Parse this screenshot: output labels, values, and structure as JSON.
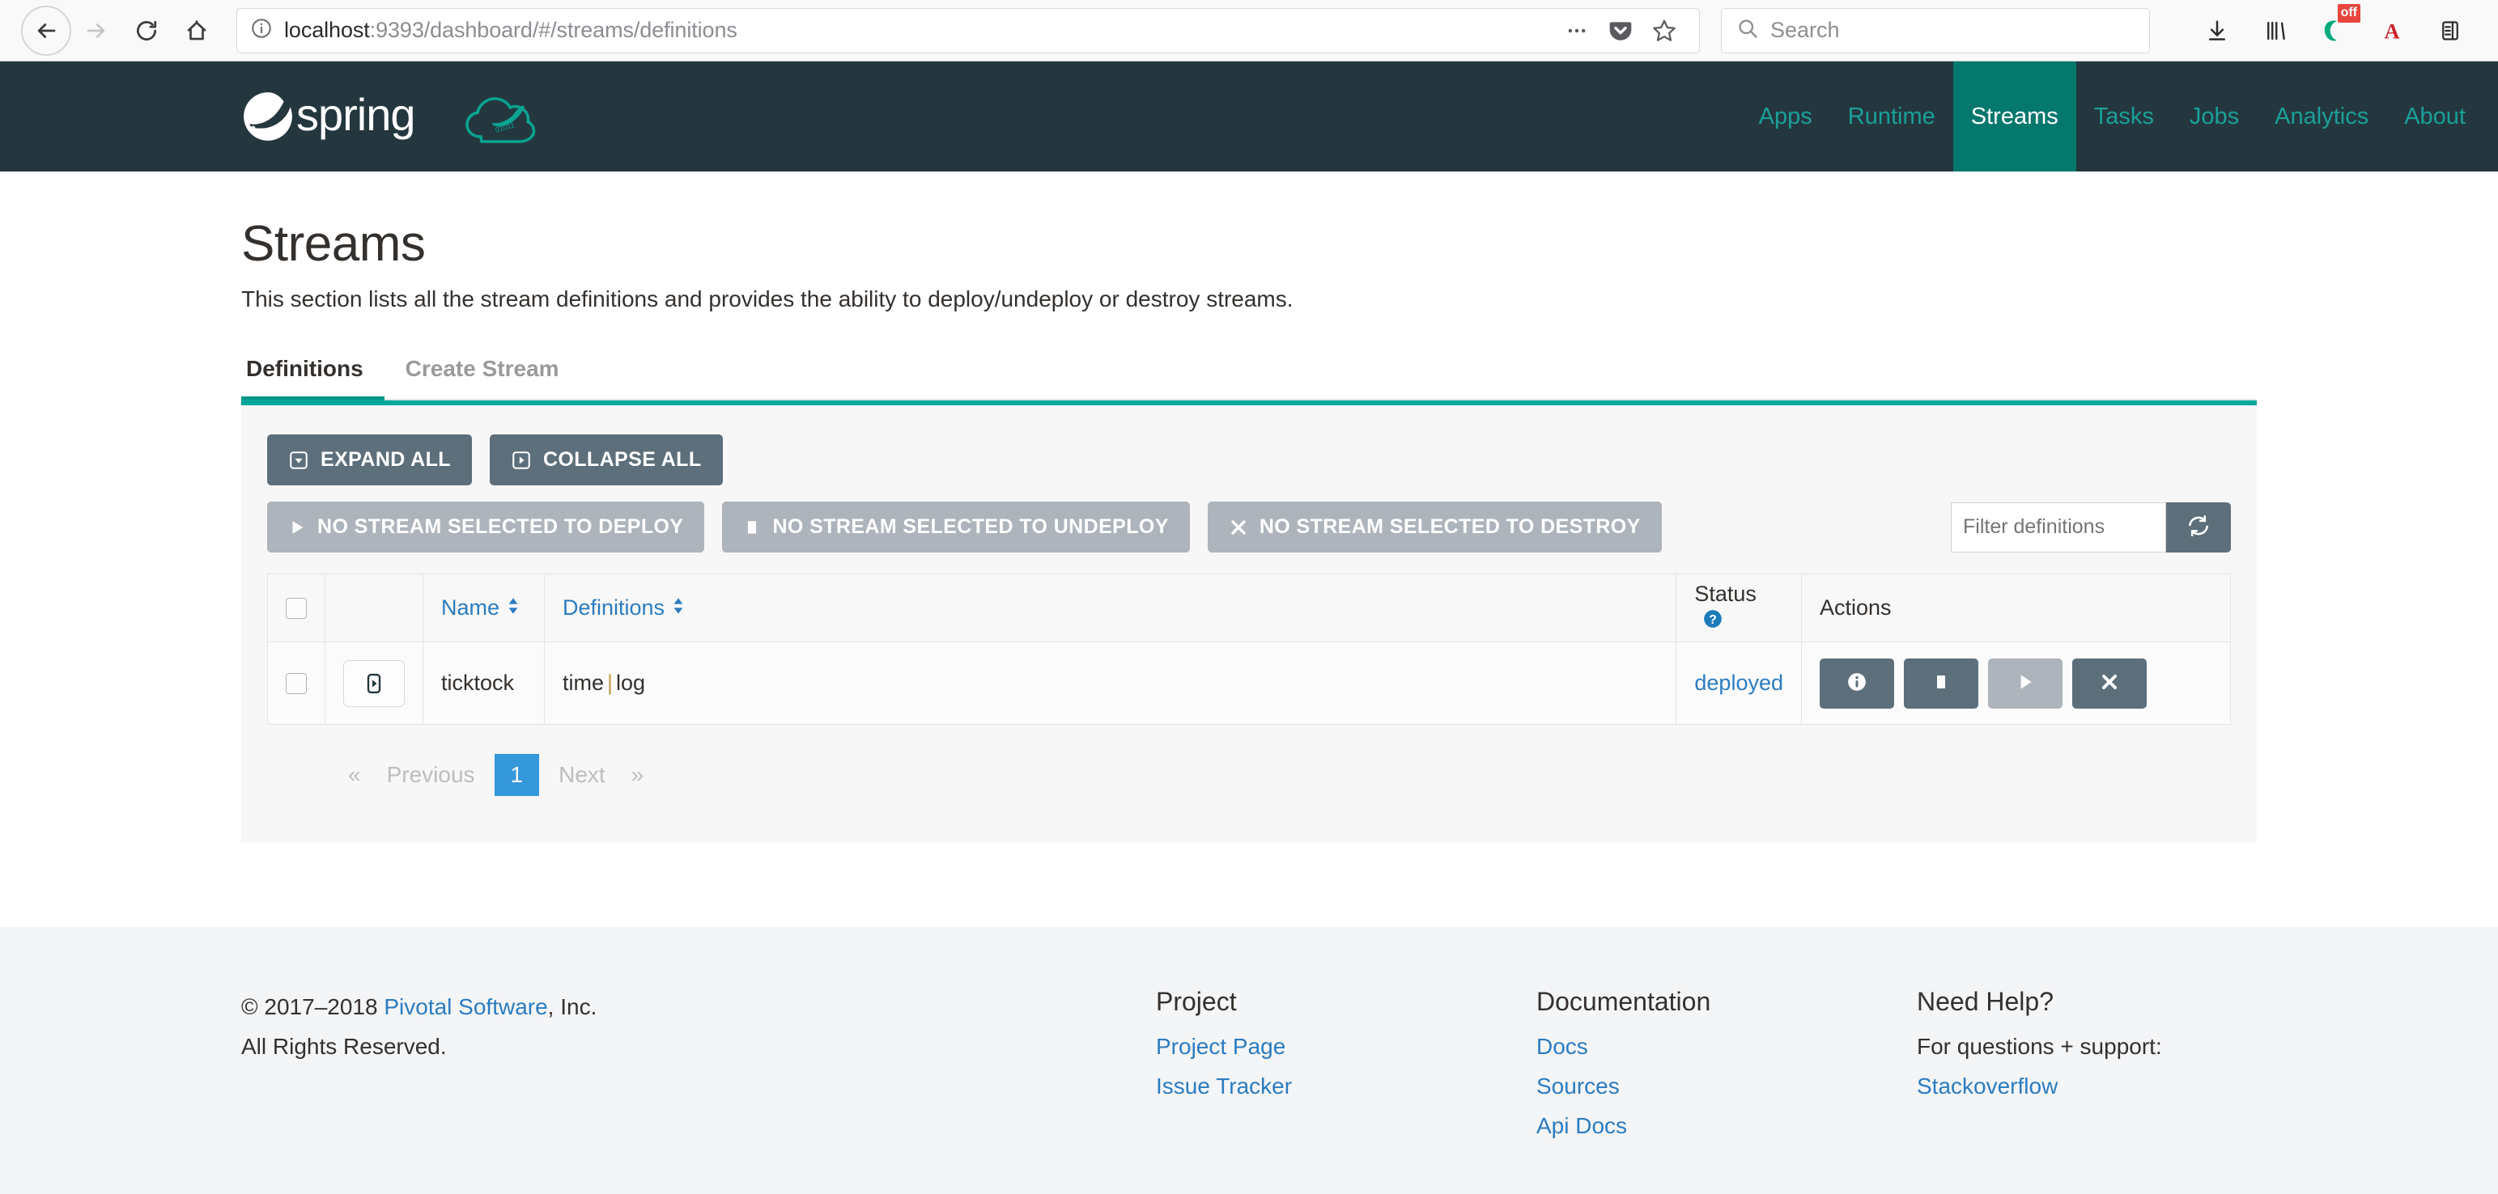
{
  "browser": {
    "url_host": "localhost",
    "url_rest": ":9393/dashboard/#/streams/definitions",
    "search_placeholder": "Search",
    "icons": {
      "back": "back-arrow-icon",
      "forward": "forward-arrow-icon",
      "reload": "reload-icon",
      "home": "home-icon",
      "info": "site-info-icon",
      "more": "page-actions-icon",
      "pocket": "pocket-icon",
      "bookmark": "bookmark-star-icon",
      "search": "search-icon",
      "downloads": "downloads-icon",
      "library": "library-icon",
      "ghostery": "ghostery-icon",
      "ghostery_badge": "off",
      "adblock": "adblock-a-icon",
      "sidebar": "reader-sidebar-icon"
    }
  },
  "navbar": {
    "brand": "spring",
    "links": [
      {
        "label": "Apps",
        "active": false
      },
      {
        "label": "Runtime",
        "active": false
      },
      {
        "label": "Streams",
        "active": true
      },
      {
        "label": "Tasks",
        "active": false
      },
      {
        "label": "Jobs",
        "active": false
      },
      {
        "label": "Analytics",
        "active": false
      },
      {
        "label": "About",
        "active": false
      }
    ]
  },
  "page": {
    "title": "Streams",
    "description": "This section lists all the stream definitions and provides the ability to deploy/undeploy or destroy streams.",
    "tabs": [
      {
        "label": "Definitions",
        "active": true
      },
      {
        "label": "Create Stream",
        "active": false
      }
    ]
  },
  "toolbar": {
    "expand_all": "EXPAND ALL",
    "collapse_all": "COLLAPSE ALL",
    "deploy": "NO STREAM SELECTED TO DEPLOY",
    "undeploy": "NO STREAM SELECTED TO UNDEPLOY",
    "destroy": "NO STREAM SELECTED TO DESTROY",
    "filter_placeholder": "Filter definitions",
    "refresh_icon": "refresh-icon"
  },
  "table": {
    "headers": {
      "name": "Name",
      "definitions": "Definitions",
      "status": "Status",
      "actions": "Actions"
    },
    "rows": [
      {
        "name": "ticktock",
        "definition_left": "time",
        "definition_sep": "|",
        "definition_right": "log",
        "status": "deployed",
        "actions": [
          {
            "name": "info-button",
            "icon": "info-icon",
            "disabled": false
          },
          {
            "name": "undeploy-button",
            "icon": "stop-square-icon",
            "disabled": false
          },
          {
            "name": "deploy-button",
            "icon": "play-icon",
            "disabled": true
          },
          {
            "name": "destroy-button",
            "icon": "close-x-icon",
            "disabled": false
          }
        ]
      }
    ]
  },
  "pagination": {
    "first": "«",
    "previous": "Previous",
    "current": "1",
    "next": "Next",
    "last": "»"
  },
  "footer": {
    "copyright_pre": "© 2017–2018 ",
    "copyright_link": "Pivotal Software",
    "copyright_post": ", Inc.",
    "rights": "All Rights Reserved.",
    "columns": [
      {
        "heading": "Project",
        "links": [
          "Project Page",
          "Issue Tracker"
        ],
        "plain": ""
      },
      {
        "heading": "Documentation",
        "links": [
          "Docs",
          "Sources",
          "Api Docs"
        ],
        "plain": ""
      },
      {
        "heading": "Need Help?",
        "plain": "For questions + support:",
        "links": [
          "Stackoverflow"
        ]
      }
    ]
  },
  "colors": {
    "navbar_bg": "#24373f",
    "nav_link": "#1aa098",
    "nav_active_bg": "#05786e",
    "panel_top_border": "#00a79d",
    "button": "#5d6f7b",
    "button_disabled": "#adb4bb",
    "link_blue": "#2b7cc0",
    "pager_active": "#3498db"
  }
}
